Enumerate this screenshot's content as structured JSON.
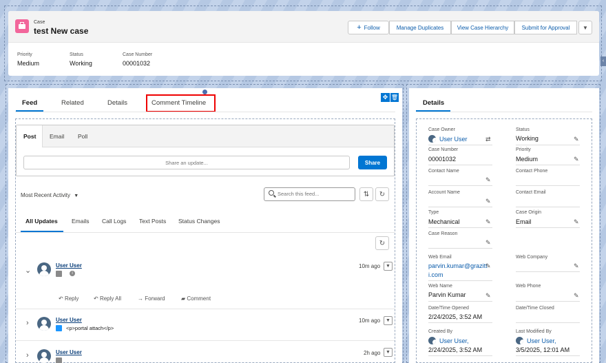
{
  "header": {
    "object_label": "Case",
    "title": "test New case",
    "buttons": {
      "follow": "Follow",
      "manage_duplicates": "Manage Duplicates",
      "view_hierarchy": "View Case Hierarchy",
      "submit_approval": "Submit for Approval"
    },
    "fields": [
      {
        "label": "Priority",
        "value": "Medium"
      },
      {
        "label": "Status",
        "value": "Working"
      },
      {
        "label": "Case Number",
        "value": "00001032"
      }
    ]
  },
  "tabs": {
    "feed": "Feed",
    "related": "Related",
    "details": "Details",
    "comment_timeline": "Comment Timeline"
  },
  "publisher": {
    "tabs": [
      "Post",
      "Email",
      "Poll"
    ],
    "placeholder": "Share an update...",
    "share_label": "Share"
  },
  "feed": {
    "sort_label": "Most Recent Activity",
    "search_placeholder": "Search this feed...",
    "filter_tabs": [
      "All Updates",
      "Emails",
      "Call Logs",
      "Text Posts",
      "Status Changes"
    ],
    "items": [
      {
        "user": "User User",
        "time": "10m ago",
        "body": ""
      },
      {
        "user": "User User",
        "time": "10m ago",
        "body": "<p>portal attach</p>"
      },
      {
        "user": "User User",
        "time": "2h ago",
        "body": ""
      }
    ],
    "actions": [
      "Reply",
      "Reply All",
      "Forward",
      "Comment"
    ]
  },
  "details": {
    "title": "Details",
    "left": [
      {
        "label": "Case Owner",
        "value": "User User"
      },
      {
        "label": "Case Number",
        "value": "00001032"
      },
      {
        "label": "Contact Name",
        "value": ""
      },
      {
        "label": "Account Name",
        "value": ""
      },
      {
        "label": "Type",
        "value": "Mechanical"
      },
      {
        "label": "Case Reason",
        "value": ""
      },
      {
        "label": "Web Email",
        "value": "parvin.kumar@grazitt",
        "value2": "i.com"
      },
      {
        "label": "Web Name",
        "value": "Parvin Kumar"
      },
      {
        "label": "Date/Time Opened",
        "value": "2/24/2025, 3:52 AM"
      },
      {
        "label": "Created By",
        "value": "User User,",
        "value2": "2/24/2025, 3:52 AM"
      }
    ],
    "right": [
      {
        "label": "Status",
        "value": "Working"
      },
      {
        "label": "Priority",
        "value": "Medium"
      },
      {
        "label": "Contact Phone",
        "value": ""
      },
      {
        "label": "Contact Email",
        "value": ""
      },
      {
        "label": "Case Origin",
        "value": "Email"
      },
      {
        "label": "Web Company",
        "value": ""
      },
      {
        "label": "Web Phone",
        "value": ""
      },
      {
        "label": "Date/Time Closed",
        "value": ""
      },
      {
        "label": "Last Modified By",
        "value": "User User,",
        "value2": "3/5/2025, 12:01 AM"
      }
    ]
  },
  "colors": {
    "brand": "#0176d3",
    "case_icon": "#f2669b",
    "highlight": "#e00000"
  }
}
